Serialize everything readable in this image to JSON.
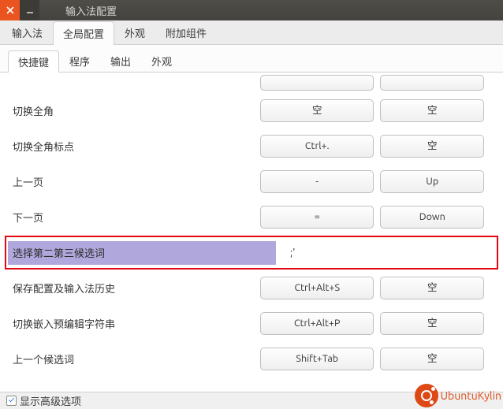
{
  "window": {
    "title": "输入法配置"
  },
  "tabs_main": {
    "items": [
      "输入法",
      "全局配置",
      "外观",
      "附加组件"
    ],
    "active": 1
  },
  "tabs_sub": {
    "items": [
      "快捷键",
      "程序",
      "输出",
      "外观"
    ],
    "active": 0
  },
  "rows": [
    {
      "label": "",
      "k1": "",
      "k2": "",
      "partial": true
    },
    {
      "label": "切换全角",
      "k1": "空",
      "k2": "空"
    },
    {
      "label": "切换全角标点",
      "k1": "Ctrl+.",
      "k2": "空"
    },
    {
      "label": "上一页",
      "k1": "-",
      "k2": "Up"
    },
    {
      "label": "下一页",
      "k1": "=",
      "k2": "Down"
    },
    {
      "label": "选择第二第三候选词",
      "value": ";'",
      "highlighted": true
    },
    {
      "label": "保存配置及输入法历史",
      "k1": "Ctrl+Alt+S",
      "k2": "空"
    },
    {
      "label": "切换嵌入预编辑字符串",
      "k1": "Ctrl+Alt+P",
      "k2": "空"
    },
    {
      "label": "上一个候选词",
      "k1": "Shift+Tab",
      "k2": "空"
    }
  ],
  "footer": {
    "checkbox_label": "显示高级选项",
    "checked": true
  },
  "logo": {
    "text": "UbuntuKylin"
  }
}
